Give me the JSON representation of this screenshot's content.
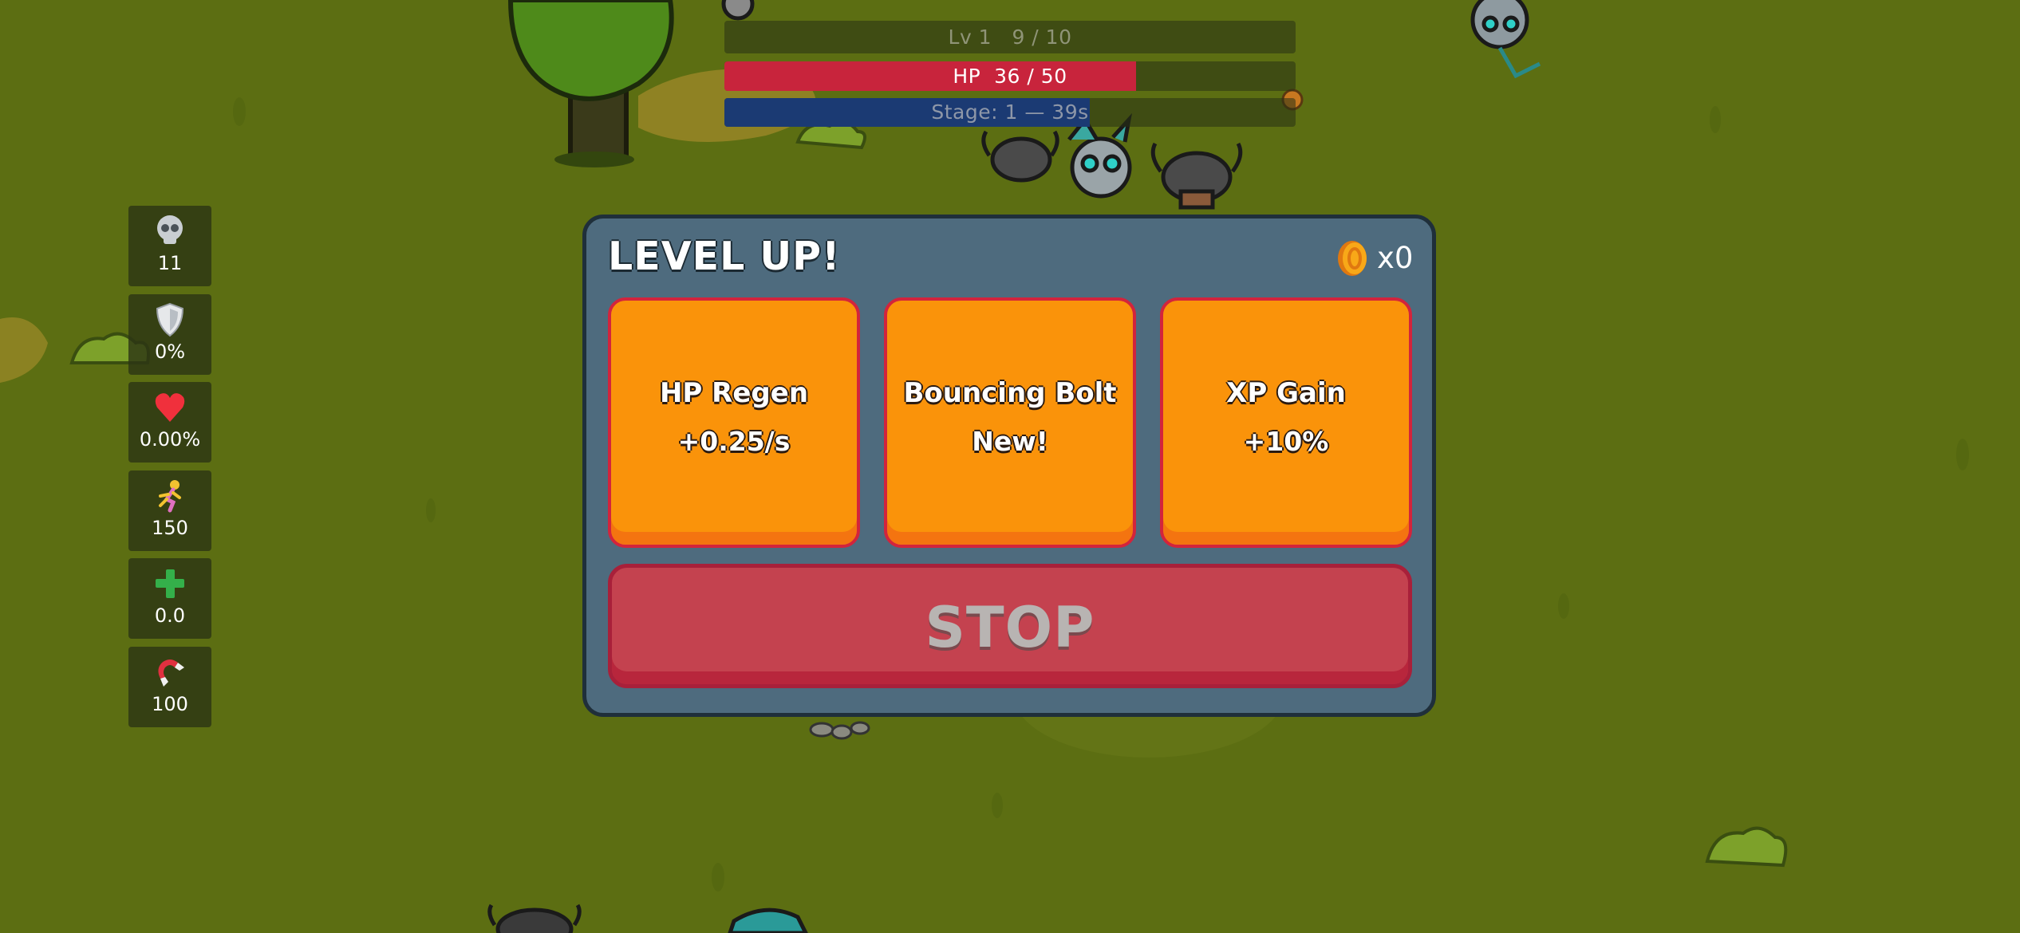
{
  "hud": {
    "level_label": "Lv 1",
    "xp_text": "9 / 10",
    "xp_fraction": 0.9,
    "hp_label": "HP",
    "hp_text": "36 / 50",
    "hp_fraction": 0.72,
    "stage_text": "Stage: 1 — 39s",
    "stage_fraction": 0.64
  },
  "stats": [
    {
      "icon": "skull-icon",
      "value": "11"
    },
    {
      "icon": "shield-icon",
      "value": "0%"
    },
    {
      "icon": "heart-icon",
      "value": "0.00%"
    },
    {
      "icon": "runner-icon",
      "value": "150"
    },
    {
      "icon": "plus-icon",
      "value": "0.0"
    },
    {
      "icon": "magnet-icon",
      "value": "100"
    }
  ],
  "modal": {
    "title": "LEVEL UP!",
    "coin_count": "x0",
    "cards": [
      {
        "name": "HP Regen",
        "desc": "+0.25/s"
      },
      {
        "name": "Bouncing Bolt",
        "desc": "New!"
      },
      {
        "name": "XP Gain",
        "desc": "+10%"
      }
    ],
    "stop_label": "STOP"
  },
  "colors": {
    "grass": "#5c6e12",
    "hp": "#c8243c",
    "stage": "#1b3a73",
    "card": "#fa930a",
    "card_border": "#d3243c",
    "stop": "#c4424f"
  }
}
